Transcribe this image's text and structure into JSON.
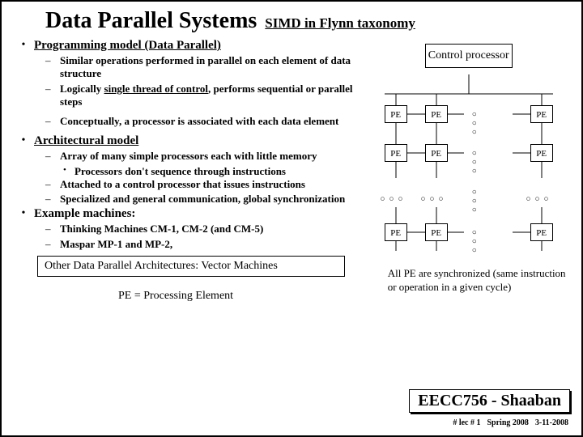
{
  "title": "Data Parallel Systems",
  "subtitle": "SIMD in Flynn taxonomy",
  "sections": [
    {
      "heading": "Programming model  (Data Parallel)",
      "items": [
        {
          "text": " Similar operations performed in parallel on each element of data structure"
        },
        {
          "text_html": "Logically <span class='u'>single thread of control</span>, performs sequential or parallel steps"
        },
        {
          "gap": true
        },
        {
          "text": "Conceptually, a processor is associated with each data element"
        }
      ]
    },
    {
      "heading": "Architectural model",
      "items": [
        {
          "text": "Array of many simple processors each with little memory",
          "sub": [
            "Processors don't sequence through instructions"
          ]
        },
        {
          "text": "Attached to a control processor that issues instructions"
        },
        {
          "text": "Specialized and general communication,  global synchronization"
        }
      ]
    },
    {
      "heading": "Example machines:",
      "items": [
        {
          "text": "Thinking Machines CM-1, CM-2 (and CM-5)"
        },
        {
          "text": "Maspar MP-1 and MP-2,"
        }
      ]
    }
  ],
  "other_box": "Other Data Parallel Architectures: Vector Machines",
  "pe_def": "PE = Processing Element",
  "diagram": {
    "control_label": "Control processor",
    "pe_label": "PE",
    "dots": "○ ○ ○"
  },
  "caption": "All PE are synchronized (same instruction or operation in a given cycle)",
  "footer": {
    "course": "EECC756 - Shaaban",
    "lec": "#  lec # 1",
    "term": "Spring 2008",
    "date": "3-11-2008"
  }
}
